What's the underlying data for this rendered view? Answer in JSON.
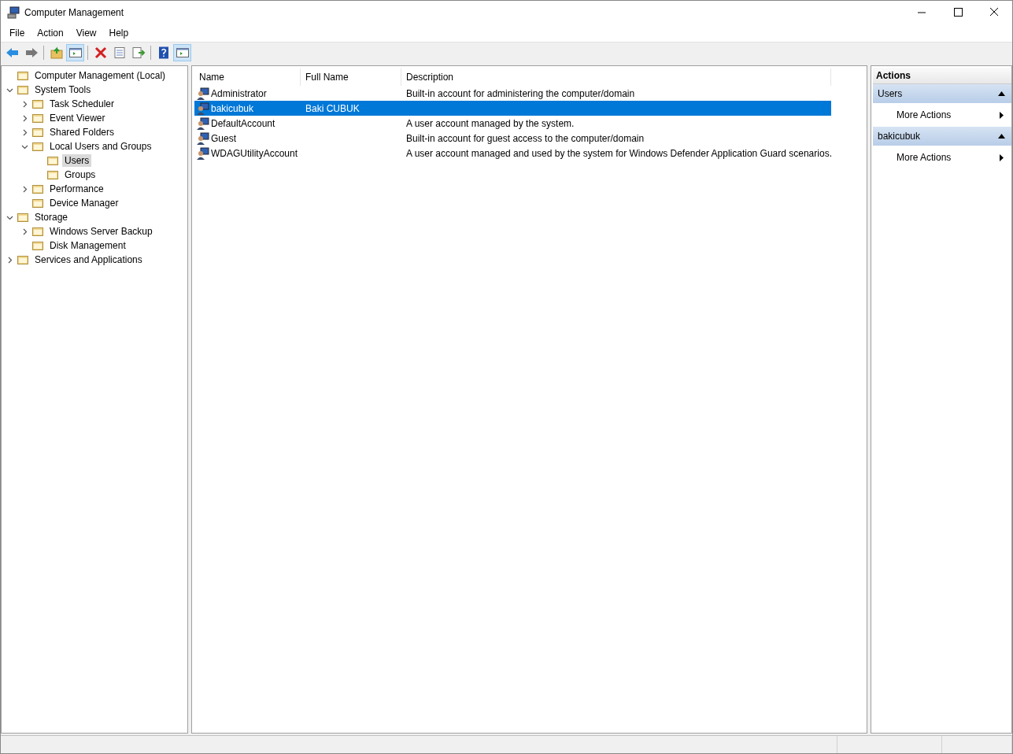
{
  "window": {
    "title": "Computer Management"
  },
  "menu": [
    "File",
    "Action",
    "View",
    "Help"
  ],
  "toolbar": [
    {
      "selected": false
    },
    {
      "selected": false
    },
    {
      "selected": false
    },
    {
      "selected": true
    },
    {
      "selected": false
    },
    {
      "selected": false
    },
    {
      "selected": false
    },
    {
      "selected": false
    },
    {
      "selected": true
    }
  ],
  "tree": [
    {
      "label": "Computer Management (Local)",
      "selected": false
    },
    {
      "label": "System Tools",
      "selected": false,
      "expanded": true,
      "children": [
        {
          "label": "Task Scheduler",
          "selected": false,
          "expanded": false
        },
        {
          "label": "Event Viewer",
          "selected": false,
          "expanded": false
        },
        {
          "label": "Shared Folders",
          "selected": false,
          "expanded": false
        },
        {
          "label": "Local Users and Groups",
          "selected": false,
          "expanded": true,
          "children": [
            {
              "label": "Users",
              "selected": true
            },
            {
              "label": "Groups",
              "selected": false
            }
          ]
        },
        {
          "label": "Performance",
          "selected": false,
          "expanded": false
        },
        {
          "label": "Device Manager",
          "selected": false
        }
      ]
    },
    {
      "label": "Storage",
      "selected": false,
      "expanded": true,
      "children": [
        {
          "label": "Windows Server Backup",
          "selected": false,
          "expanded": false
        },
        {
          "label": "Disk Management",
          "selected": false
        }
      ]
    },
    {
      "label": "Services and Applications",
      "selected": false,
      "expanded": false
    }
  ],
  "table": {
    "columns": [
      "Name",
      "Full Name",
      "Description"
    ],
    "rows": [
      {
        "name": "Administrator",
        "full_name": "",
        "description": "Built-in account for administering the computer/domain",
        "selected": false
      },
      {
        "name": "bakicubuk",
        "full_name": "Baki CUBUK",
        "description": "",
        "selected": true
      },
      {
        "name": "DefaultAccount",
        "full_name": "",
        "description": "A user account managed by the system.",
        "selected": false
      },
      {
        "name": "Guest",
        "full_name": "",
        "description": "Built-in account for guest access to the computer/domain",
        "selected": false
      },
      {
        "name": "WDAGUtilityAccount",
        "full_name": "",
        "description": "A user account managed and used by the system for Windows Defender Application Guard scenarios.",
        "selected": false
      }
    ]
  },
  "actions": {
    "title": "Actions",
    "sections": [
      {
        "title": "Users",
        "items": [
          "More Actions"
        ]
      },
      {
        "title": "bakicubuk",
        "items": [
          "More Actions"
        ]
      }
    ]
  }
}
